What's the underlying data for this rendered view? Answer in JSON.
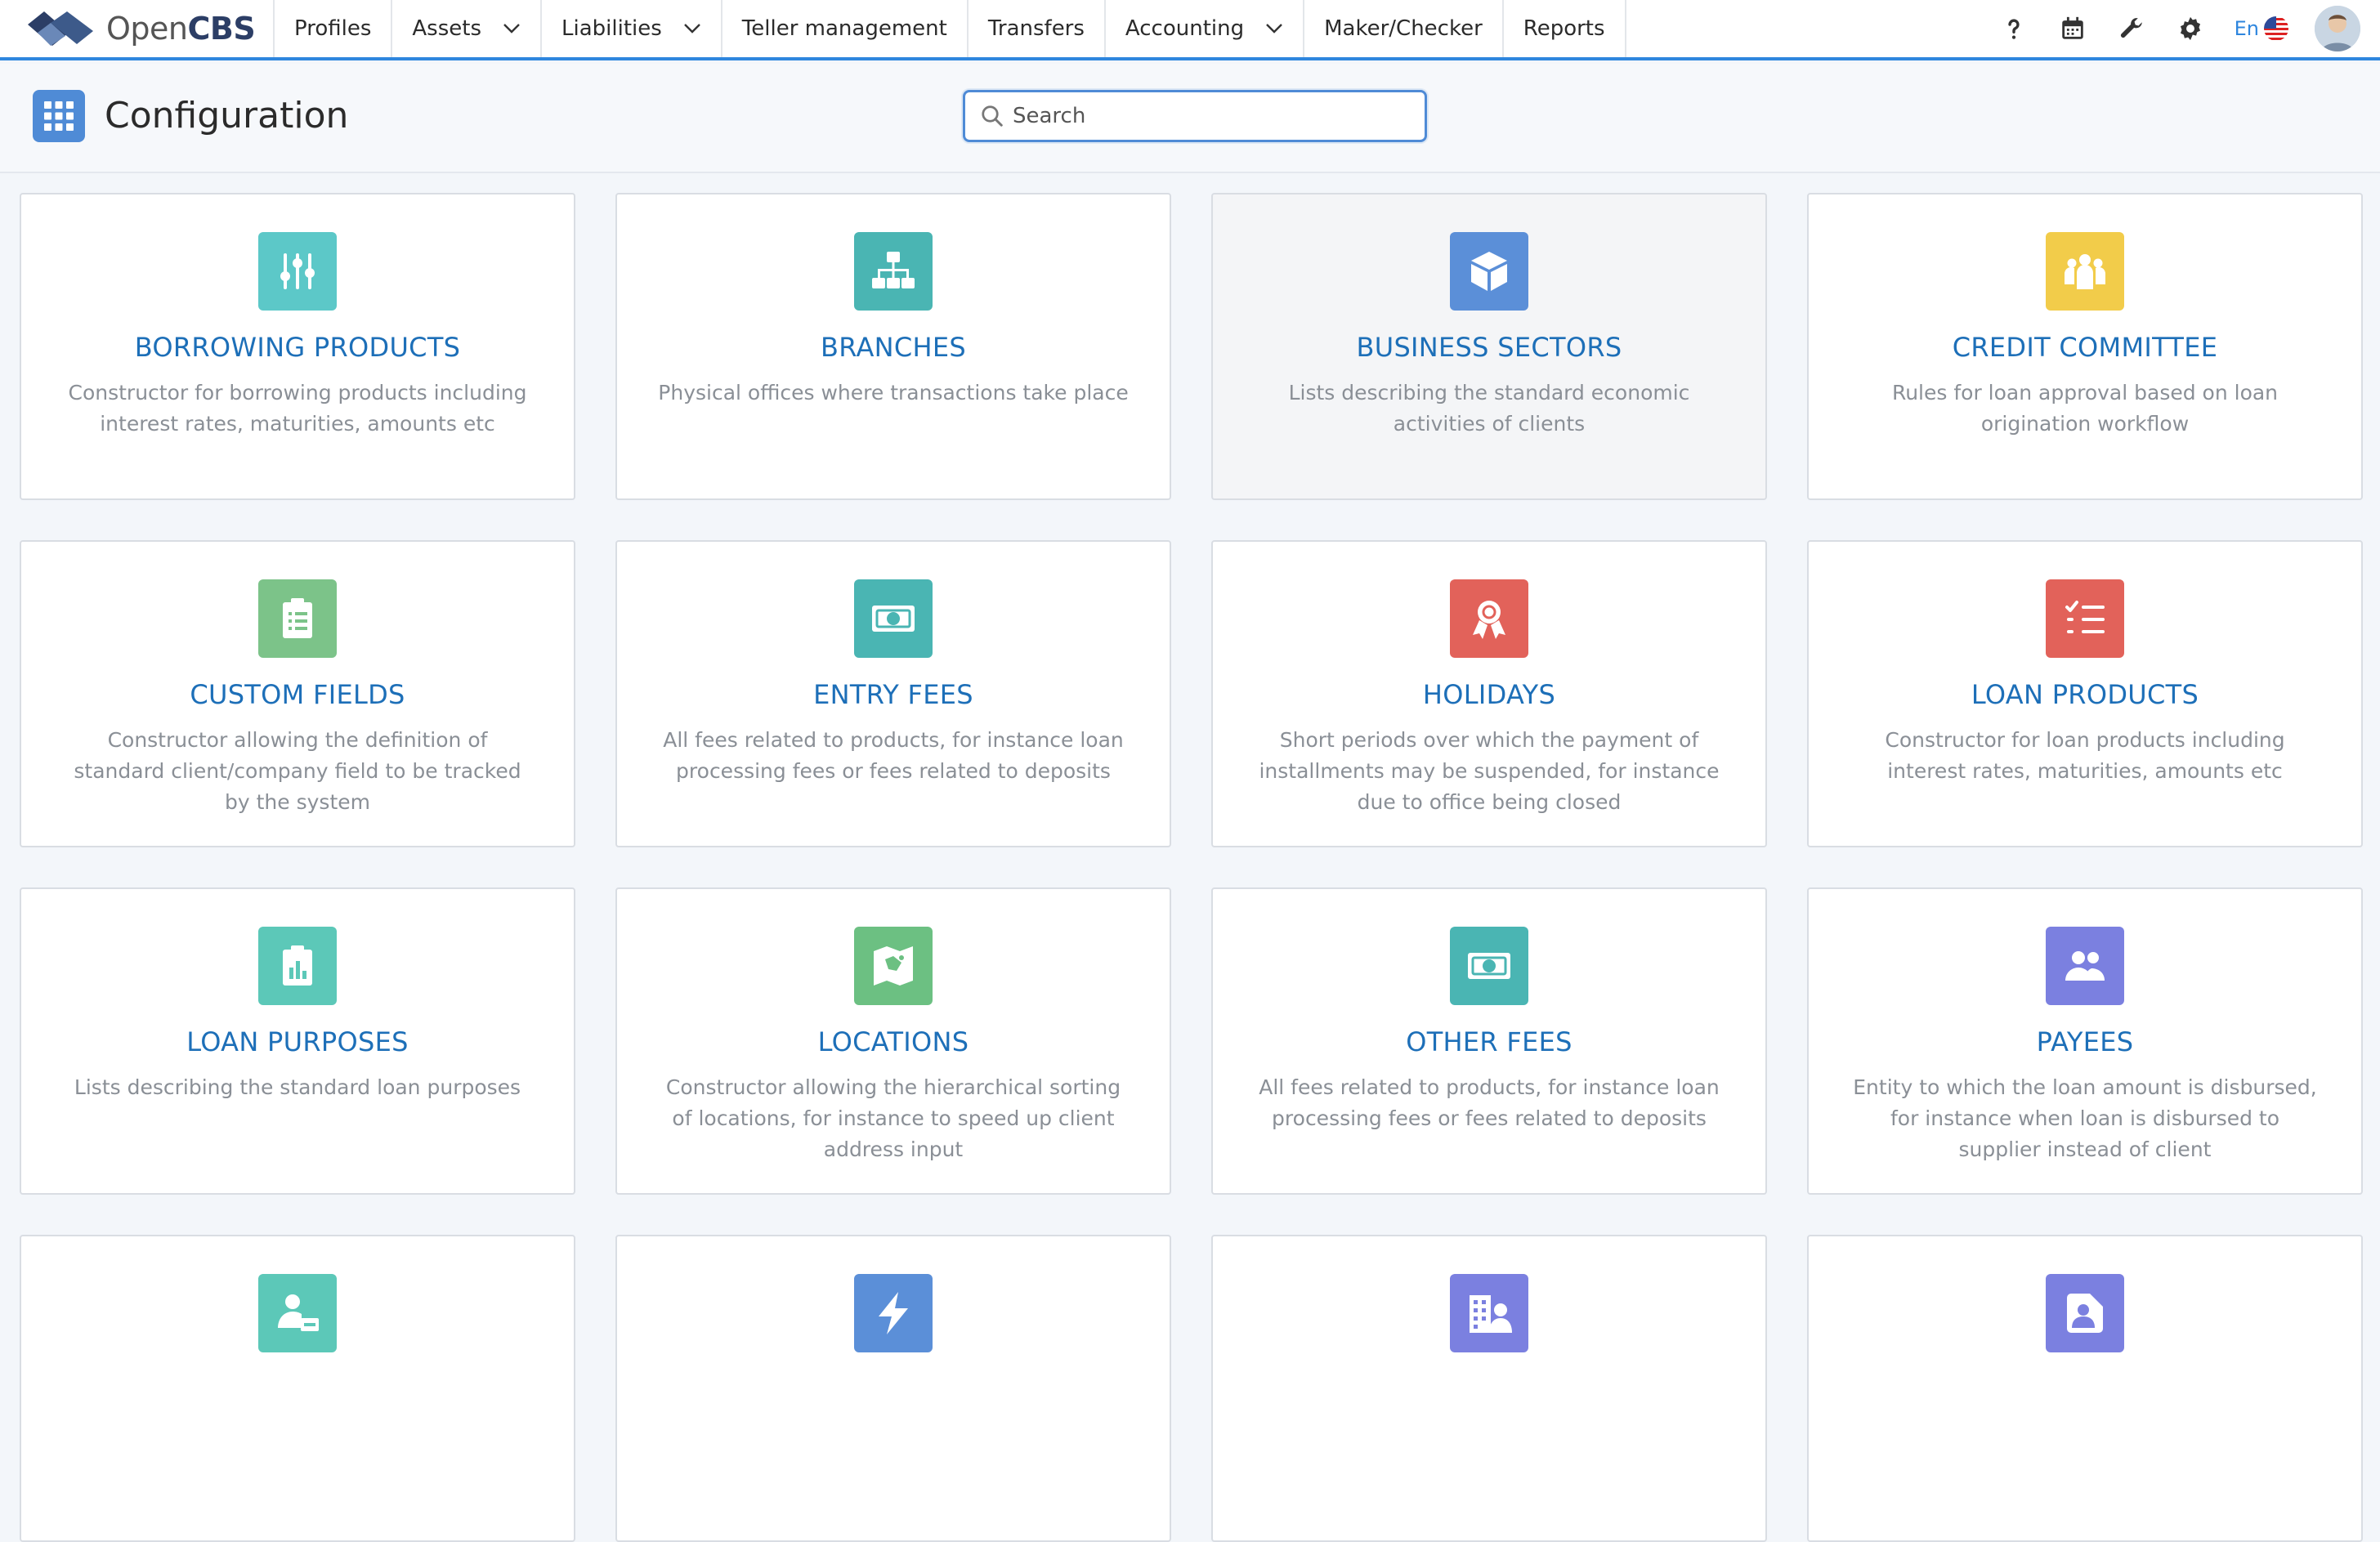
{
  "app": {
    "brand_light": "Open",
    "brand_bold": "CBS"
  },
  "nav": [
    {
      "label": "Profiles",
      "dropdown": false
    },
    {
      "label": "Assets",
      "dropdown": true
    },
    {
      "label": "Liabilities",
      "dropdown": true
    },
    {
      "label": "Teller management",
      "dropdown": false
    },
    {
      "label": "Transfers",
      "dropdown": false
    },
    {
      "label": "Accounting",
      "dropdown": true
    },
    {
      "label": "Maker/Checker",
      "dropdown": false
    },
    {
      "label": "Reports",
      "dropdown": false
    }
  ],
  "topright": {
    "language": "En"
  },
  "header": {
    "title": "Configuration"
  },
  "search": {
    "placeholder": "Search",
    "value": ""
  },
  "colors": {
    "accent": "#2e86de",
    "title_link": "#1d6fb8",
    "teal": "#5cc8c8",
    "blue": "#5b8fd8",
    "yellow": "#f2cc4a",
    "green": "#6cc082",
    "red": "#e2625a",
    "purple": "#7b80e0"
  },
  "cards": [
    {
      "title": "BORROWING PRODUCTS",
      "desc": "Constructor for borrowing products including interest rates, maturities, amounts etc",
      "icon": "sliders-icon",
      "color": "#5cc8c8"
    },
    {
      "title": "BRANCHES",
      "desc": "Physical offices where transactions take place",
      "icon": "sitemap-icon",
      "color": "#4ab5b3"
    },
    {
      "title": "BUSINESS SECTORS",
      "desc": "Lists describing the standard economic activities of clients",
      "icon": "cube-icon",
      "color": "#5b8fd8"
    },
    {
      "title": "CREDIT COMMITTEE",
      "desc": "Rules for loan approval based on loan origination workflow",
      "icon": "group-icon",
      "color": "#f2cc4a"
    },
    {
      "title": "CUSTOM FIELDS",
      "desc": "Constructor allowing the definition of standard client/company field to be tracked by the system",
      "icon": "clipboard-list-icon",
      "color": "#7cc389"
    },
    {
      "title": "ENTRY FEES",
      "desc": "All fees related to products, for instance loan processing fees or fees related to deposits",
      "icon": "money-icon",
      "color": "#4ab5b3"
    },
    {
      "title": "HOLIDAYS",
      "desc": "Short periods over which the payment of installments may be suspended, for instance due to office being closed",
      "icon": "award-icon",
      "color": "#e2625a"
    },
    {
      "title": "LOAN PRODUCTS",
      "desc": "Constructor for loan products including interest rates, maturities, amounts etc",
      "icon": "checklist-icon",
      "color": "#e2625a"
    },
    {
      "title": "LOAN PURPOSES",
      "desc": "Lists describing the standard loan purposes",
      "icon": "clipboard-chart-icon",
      "color": "#5cc8b8"
    },
    {
      "title": "LOCATIONS",
      "desc": "Constructor allowing the hierarchical sorting of locations, for instance to speed up client address input",
      "icon": "map-icon",
      "color": "#6cc082"
    },
    {
      "title": "OTHER FEES",
      "desc": "All fees related to products, for instance loan processing fees or fees related to deposits",
      "icon": "money-icon",
      "color": "#4ab5b3"
    },
    {
      "title": "PAYEES",
      "desc": "Entity to which the loan amount is disbursed, for instance when loan is disbursed to supplier instead of client",
      "icon": "users-icon",
      "color": "#7b80e0"
    },
    {
      "title": "",
      "desc": "",
      "icon": "person-card-icon",
      "color": "#5cc8b8"
    },
    {
      "title": "",
      "desc": "",
      "icon": "lightning-icon",
      "color": "#5b8fd8"
    },
    {
      "title": "",
      "desc": "",
      "icon": "building-person-icon",
      "color": "#7b80e0"
    },
    {
      "title": "",
      "desc": "",
      "icon": "portrait-icon",
      "color": "#7b80e0"
    }
  ]
}
